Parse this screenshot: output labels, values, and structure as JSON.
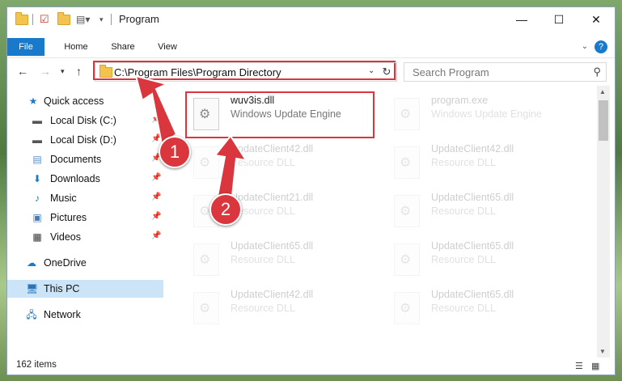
{
  "window": {
    "title": "Program",
    "controls": {
      "minimize": "—",
      "maximize": "☐",
      "close": "✕"
    }
  },
  "ribbon": {
    "tabs": [
      "File",
      "Home",
      "Share",
      "View"
    ],
    "help": "?"
  },
  "address_bar": {
    "path": "C:\\Program Files\\Program Directory",
    "refresh_icon": "↻"
  },
  "search": {
    "placeholder": "Search Program"
  },
  "sidebar": {
    "items": [
      {
        "label": "Quick access",
        "icon": "star-icon"
      },
      {
        "label": "Local Disk (C:)",
        "icon": "drive-icon",
        "pinned": true
      },
      {
        "label": "Local Disk (D:)",
        "icon": "drive-icon",
        "pinned": true
      },
      {
        "label": "Documents",
        "icon": "documents-icon",
        "pinned": true
      },
      {
        "label": "Downloads",
        "icon": "download-icon",
        "pinned": true
      },
      {
        "label": "Music",
        "icon": "music-icon",
        "pinned": true
      },
      {
        "label": "Pictures",
        "icon": "pictures-icon",
        "pinned": true
      },
      {
        "label": "Videos",
        "icon": "videos-icon",
        "pinned": true
      },
      {
        "label": "OneDrive",
        "icon": "cloud-icon"
      },
      {
        "label": "This PC",
        "icon": "computer-icon",
        "selected": true
      },
      {
        "label": "Network",
        "icon": "network-icon"
      }
    ]
  },
  "files": [
    {
      "name": "wuv3is.dll",
      "desc": "Windows Update Engine"
    },
    {
      "name": "program.exe",
      "desc": "Windows Update Engine"
    },
    {
      "name": "UpdateClient42.dll",
      "desc": "Resource DLL"
    },
    {
      "name": "UpdateClient42.dll",
      "desc": "Resource DLL"
    },
    {
      "name": "UpdateClient21.dll",
      "desc": "Resource DLL"
    },
    {
      "name": "UpdateClient65.dll",
      "desc": "Resource DLL"
    },
    {
      "name": "UpdateClient65.dll",
      "desc": "Resource DLL"
    },
    {
      "name": "UpdateClient65.dll",
      "desc": "Resource DLL"
    },
    {
      "name": "UpdateClient42.dll",
      "desc": "Resource DLL"
    },
    {
      "name": "UpdateClient65.dll",
      "desc": "Resource DLL"
    }
  ],
  "status": {
    "item_count": "162 items"
  },
  "annotations": {
    "step1": "1",
    "step2": "2"
  },
  "colors": {
    "accent": "#1979ca",
    "highlight": "#d9363e",
    "selection": "#cce4f7"
  }
}
